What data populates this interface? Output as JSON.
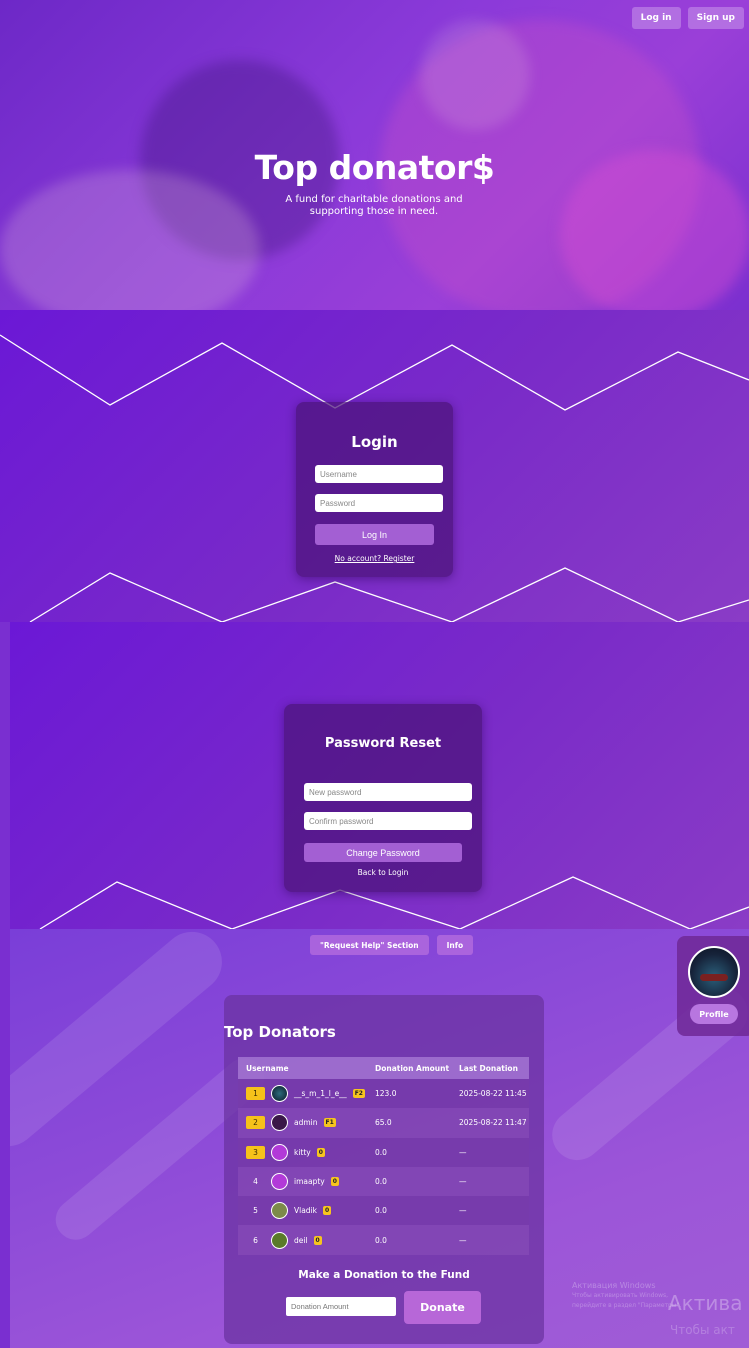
{
  "hero": {
    "title": "Top donator$",
    "subtitle": "A fund for charitable donations and supporting those in need.",
    "login_label": "Log in",
    "signup_label": "Sign up"
  },
  "login": {
    "title": "Login",
    "username_placeholder": "Username",
    "password_placeholder": "Password",
    "submit_label": "Log In",
    "register_link": "No account? Register"
  },
  "reset": {
    "title": "Password Reset",
    "new_password_placeholder": "New password",
    "confirm_password_placeholder": "Confirm password",
    "submit_label": "Change Password",
    "back_link": "Back to Login"
  },
  "nav": {
    "request_help_label": "\"Request Help\" Section",
    "info_label": "Info",
    "profile_label": "Profile"
  },
  "donators": {
    "title": "Top Donators",
    "columns": [
      "Username",
      "Donation Amount",
      "Last Donation"
    ],
    "rows": [
      {
        "rank": "1",
        "username": "__s_m_1_l_e__",
        "level": "F2",
        "amount": "123.0",
        "last": "2025-08-22 11:45"
      },
      {
        "rank": "2",
        "username": "admin",
        "level": "F1",
        "amount": "65.0",
        "last": "2025-08-22 11:47"
      },
      {
        "rank": "3",
        "username": "kitty",
        "level": "0",
        "amount": "0.0",
        "last": "—"
      },
      {
        "rank": "4",
        "username": "imaapty",
        "level": "0",
        "amount": "0.0",
        "last": "—"
      },
      {
        "rank": "5",
        "username": "Vladik",
        "level": "0",
        "amount": "0.0",
        "last": "—"
      },
      {
        "rank": "6",
        "username": "deil",
        "level": "0",
        "amount": "0.0",
        "last": "—"
      }
    ],
    "donate_title": "Make a Donation to the Fund",
    "amount_placeholder": "Donation Amount",
    "donate_label": "Donate"
  },
  "watermark": {
    "line1": "Активация Windows",
    "line2": "Чтобы активировать Windows, перейдите в раздел \"Параметры\".",
    "big1": "Актива",
    "big2": "Чтобы акт"
  },
  "colors": {
    "accent": "#a35fd3",
    "gold": "#f6c21a",
    "background": "#7a2fd0"
  }
}
